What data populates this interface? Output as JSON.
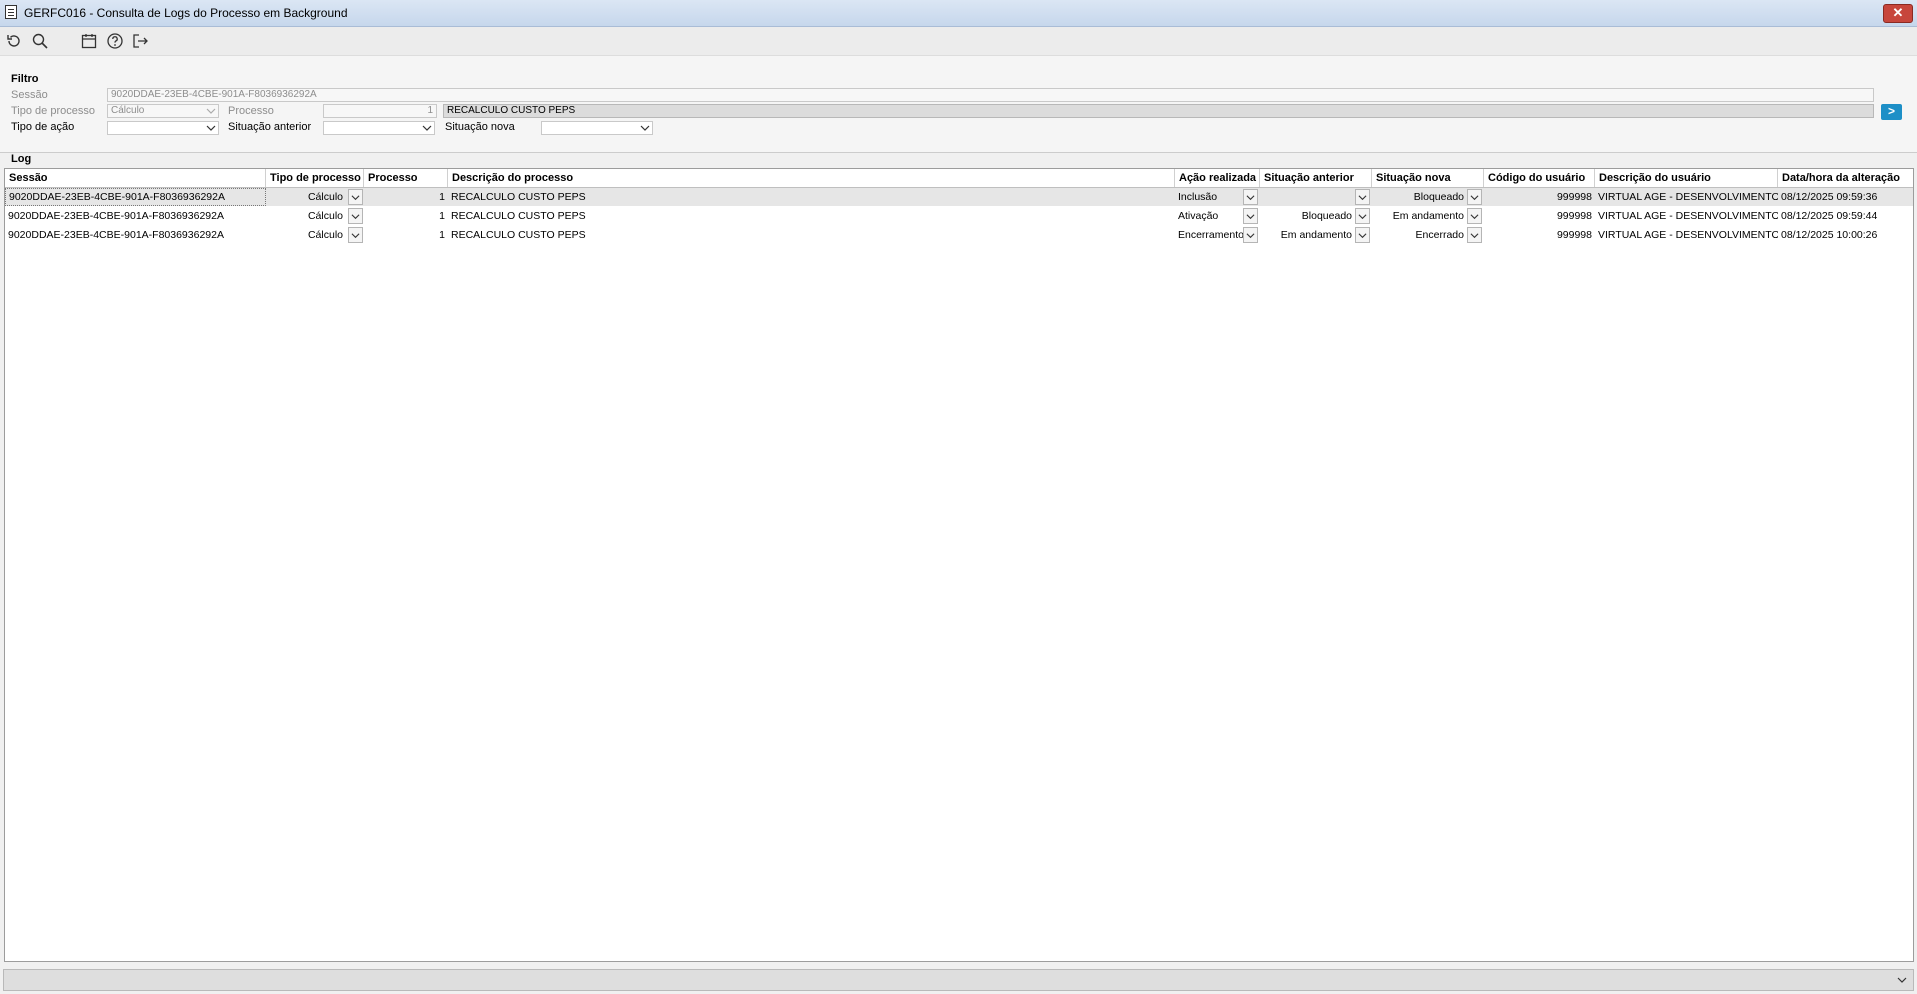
{
  "window": {
    "title": "GERFC016 - Consulta de Logs do Processo em Background",
    "close_label": "✕"
  },
  "toolbar": {
    "icons": [
      "refresh-icon",
      "search-icon",
      "calendar-icon",
      "help-icon",
      "exit-icon"
    ]
  },
  "filter": {
    "title": "Filtro",
    "sessao_label": "Sessão",
    "sessao_value": "9020DDAE-23EB-4CBE-901A-F8036936292A",
    "tipo_processo_label": "Tipo de processo",
    "tipo_processo_value": "Cálculo",
    "processo_label": "Processo",
    "processo_value": "1",
    "processo_descricao": "RECALCULO CUSTO PEPS",
    "tipo_acao_label": "Tipo de ação",
    "tipo_acao_value": "",
    "situacao_anterior_label": "Situação anterior",
    "situacao_anterior_value": "",
    "situacao_nova_label": "Situação nova",
    "situacao_nova_value": "",
    "go_label": ">"
  },
  "log": {
    "title": "Log",
    "columns": [
      "Sessão",
      "Tipo de processo",
      "Processo",
      "Descrição do processo",
      "Ação realizada",
      "Situação anterior",
      "Situação nova",
      "Código do usuário",
      "Descrição do usuário",
      "Data/hora da alteração"
    ],
    "rows": [
      [
        "9020DDAE-23EB-4CBE-901A-F8036936292A",
        "Cálculo",
        "1",
        "RECALCULO CUSTO PEPS",
        "Inclusão",
        "",
        "Bloqueado",
        "999998",
        "VIRTUAL AGE - DESENVOLVIMENTO",
        "08/12/2025 09:59:36"
      ],
      [
        "9020DDAE-23EB-4CBE-901A-F8036936292A",
        "Cálculo",
        "1",
        "RECALCULO CUSTO PEPS",
        "Ativação",
        "Bloqueado",
        "Em andamento",
        "999998",
        "VIRTUAL AGE - DESENVOLVIMENTO",
        "08/12/2025 09:59:44"
      ],
      [
        "9020DDAE-23EB-4CBE-901A-F8036936292A",
        "Cálculo",
        "1",
        "RECALCULO CUSTO PEPS",
        "Encerramento",
        "Em andamento",
        "Encerrado",
        "999998",
        "VIRTUAL AGE - DESENVOLVIMENTO",
        "08/12/2025 10:00:26"
      ]
    ]
  },
  "colors": {
    "go_button": "#1d8fc7",
    "close_button": "#c7463c",
    "selected_row": "#e6e6e6"
  }
}
